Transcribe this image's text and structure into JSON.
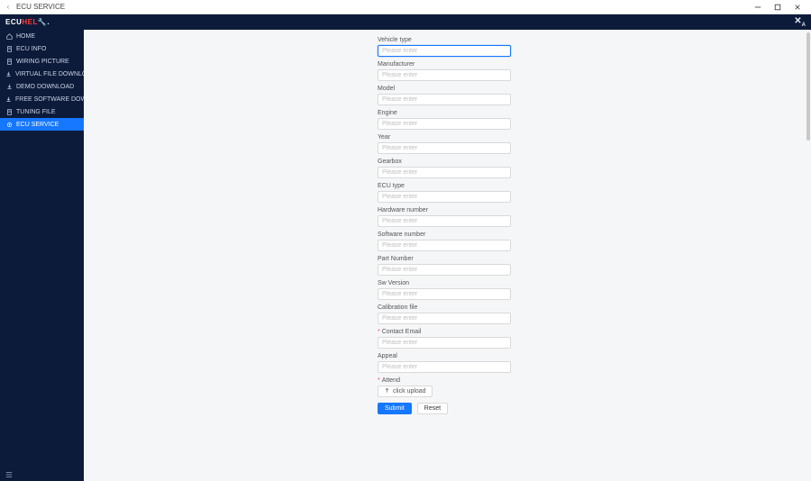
{
  "window": {
    "title": "ECU SERVICE"
  },
  "brand": {
    "text_a": "ECU",
    "text_b": "HEL",
    "text_c": "."
  },
  "sidebar": {
    "items": [
      {
        "label": "HOME",
        "icon": "home-icon"
      },
      {
        "label": "ECU INFO",
        "icon": "file-icon"
      },
      {
        "label": "WIRING PICTURE",
        "icon": "file-icon"
      },
      {
        "label": "VIRTUAL FILE DOWNLOAD",
        "icon": "download-icon"
      },
      {
        "label": "DEMO DOWNLOAD",
        "icon": "download-icon"
      },
      {
        "label": "FREE SOFTWARE DOWNLO...",
        "icon": "download-icon"
      },
      {
        "label": "TUNING FILE",
        "icon": "file-icon"
      },
      {
        "label": "ECU SERVICE",
        "icon": "service-icon"
      }
    ],
    "active_index": 7
  },
  "form": {
    "placeholder": "Please enter",
    "fields": [
      {
        "label": "Vehicle type",
        "required": false,
        "focused": true
      },
      {
        "label": "Manufacturer",
        "required": false
      },
      {
        "label": "Model",
        "required": false
      },
      {
        "label": "Engine",
        "required": false
      },
      {
        "label": "Year",
        "required": false
      },
      {
        "label": "Gearbox",
        "required": false
      },
      {
        "label": "ECU type",
        "required": false
      },
      {
        "label": "Hardware number",
        "required": false
      },
      {
        "label": "Software number",
        "required": false
      },
      {
        "label": "Part Number",
        "required": false
      },
      {
        "label": "Sw Version",
        "required": false
      },
      {
        "label": "Calibration file",
        "required": false
      },
      {
        "label": "Contact Email",
        "required": true
      },
      {
        "label": "Appeal",
        "required": false
      }
    ],
    "attend_label": "Attend",
    "attend_required": true,
    "upload_label": "click upload",
    "submit_label": "Submit",
    "reset_label": "Reset"
  }
}
